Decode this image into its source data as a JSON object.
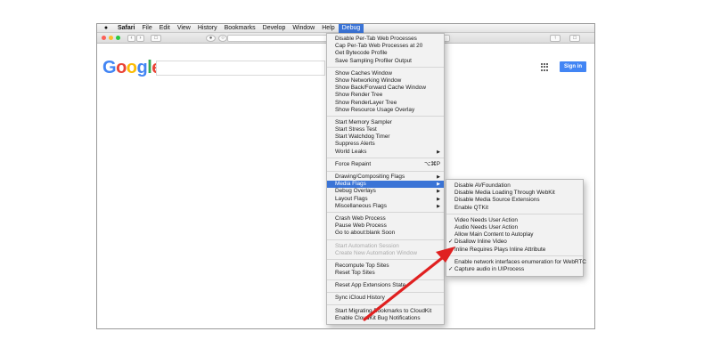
{
  "menubar": {
    "apple": "",
    "items": [
      "Safari",
      "File",
      "Edit",
      "View",
      "History",
      "Bookmarks",
      "Develop",
      "Window",
      "Help",
      "Debug"
    ]
  },
  "google": {
    "logo_letters": [
      {
        "ch": "G",
        "color": "#4285f4"
      },
      {
        "ch": "o",
        "color": "#ea4335"
      },
      {
        "ch": "o",
        "color": "#fbbc05"
      },
      {
        "ch": "g",
        "color": "#4285f4"
      },
      {
        "ch": "l",
        "color": "#34a853"
      },
      {
        "ch": "e",
        "color": "#ea4335"
      }
    ],
    "sign_in": "Sign in"
  },
  "debug_menu": {
    "groups": [
      [
        "Disable Per-Tab Web Processes",
        "Cap Per-Tab Web Processes at 20",
        "Get Bytecode Profile",
        "Save Sampling Profiler Output"
      ],
      [
        "Show Caches Window",
        "Show Networking Window",
        "Show Back/Forward Cache Window",
        "Show Render Tree",
        "Show RenderLayer Tree",
        "Show Resource Usage Overlay"
      ],
      [
        "Start Memory Sampler",
        "Start Stress Test",
        "Start Watchdog Timer",
        "Suppress Alerts",
        "World Leaks"
      ],
      [
        "Force Repaint"
      ],
      [
        "Drawing/Compositing Flags",
        "Media Flags",
        "Debug Overlays",
        "Layout Flags",
        "Miscellaneous Flags"
      ],
      [
        "Crash Web Process",
        "Pause Web Process",
        "Go to about:blank Soon"
      ],
      [
        "Start Automation Session",
        "Create New Automation Window"
      ],
      [
        "Recompute Top Sites",
        "Reset Top Sites"
      ],
      [
        "Reset App Extensions State"
      ],
      [
        "Sync iCloud History"
      ],
      [
        "Start Migrating Bookmarks to CloudKit",
        "Enable CloudKit Bug Notifications"
      ]
    ],
    "submenu_items": [
      "World Leaks",
      "Drawing/Compositing Flags",
      "Media Flags",
      "Debug Overlays",
      "Layout Flags",
      "Miscellaneous Flags"
    ],
    "disabled_items": [
      "Start Automation Session",
      "Create New Automation Window"
    ],
    "highlighted_item": "Media Flags",
    "shortcuts": {
      "Force Repaint": "⌥⌘P"
    }
  },
  "media_menu": {
    "groups": [
      [
        "Disable AVFoundation",
        "Disable Media Loading Through WebKit",
        "Disable Media Source Extensions",
        "Enable QTKit"
      ],
      [
        "Video Needs User Action",
        "Audio Needs User Action",
        "Allow Main Content to Autoplay",
        "Disallow Inline Video",
        "Inline Requires Plays Inline Attribute"
      ],
      [
        "Enable network interfaces enumeration for WebRTC",
        "Capture audio in UIProcess"
      ]
    ],
    "checked_items": [
      "Disallow Inline Video",
      "Capture audio in UIProcess"
    ]
  },
  "colors": {
    "highlight": "#3b74d6",
    "annotation_arrow": "#e02020",
    "google_blue": "#4285f4"
  },
  "icons": {
    "traffic_lights": [
      "close-icon",
      "minimize-icon",
      "zoom-icon"
    ],
    "toolbar": [
      "back-icon",
      "forward-icon",
      "sidebar-icon",
      "privacy-icon",
      "extension-icon",
      "share-icon",
      "tabs-icon"
    ]
  }
}
